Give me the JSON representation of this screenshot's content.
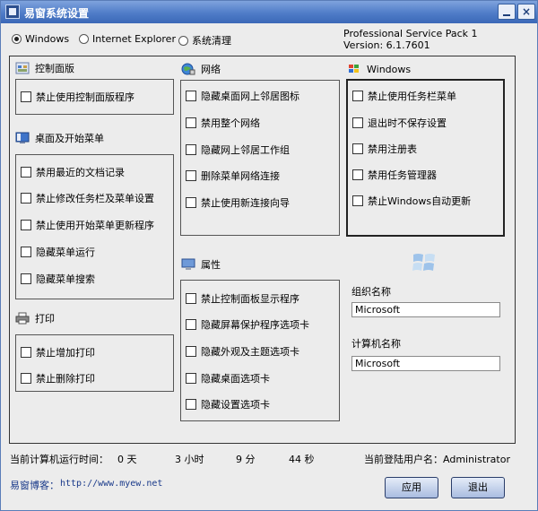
{
  "window": {
    "title": "易窗系统设置"
  },
  "tabs": [
    {
      "label": "Windows",
      "selected": true
    },
    {
      "label": "Internet Explorer",
      "selected": false
    },
    {
      "label": "系统清理",
      "selected": false
    }
  ],
  "sysinfo": {
    "line1": "Professional Service Pack 1",
    "line2": "Version: 6.1.7601"
  },
  "control_panel": {
    "title": "控制面版",
    "items": [
      "禁止使用控制面版程序"
    ]
  },
  "desktop_start": {
    "title": "桌面及开始菜单",
    "items": [
      "禁用最近的文档记录",
      "禁止修改任务栏及菜单设置",
      "禁止使用开始菜单更新程序",
      "隐藏菜单运行",
      "隐藏菜单搜索"
    ]
  },
  "print": {
    "title": "打印",
    "items": [
      "禁止增加打印",
      "禁止删除打印"
    ]
  },
  "network": {
    "title": "网络",
    "items": [
      "隐藏桌面网上邻居图标",
      "禁用整个网络",
      "隐藏网上邻居工作组",
      "删除菜单网络连接",
      "禁止使用新连接向导"
    ]
  },
  "properties": {
    "title": "属性",
    "items": [
      "禁止控制面板显示程序",
      "隐藏屏幕保护程序选项卡",
      "隐藏外观及主题选项卡",
      "隐藏桌面选项卡",
      "隐藏设置选项卡"
    ]
  },
  "windows_group": {
    "title": "Windows",
    "items": [
      "禁止使用任务栏菜单",
      "退出时不保存设置",
      "禁用注册表",
      "禁用任务管理器",
      "禁止Windows自动更新"
    ]
  },
  "org": {
    "label": "组织名称",
    "value": "Microsoft"
  },
  "computer": {
    "label": "计算机名称",
    "value": "Microsoft"
  },
  "status": {
    "uptime_label": "当前计算机运行时间：",
    "days": "0 天",
    "hours": "3 小时",
    "minutes": "9 分",
    "seconds": "44 秒",
    "user_label": "当前登陆用户名：Administrator"
  },
  "footer": {
    "blog_label": "易窗博客：",
    "blog_url": "http://www.myew.net",
    "apply": "应用",
    "exit": "退出"
  },
  "colors": {
    "titlebar": "#4f7cc8",
    "accent": "#3b68b7"
  },
  "icons": {
    "control_panel": "control-panel-icon",
    "desktop": "desktop-icon",
    "print": "printer-icon",
    "network": "network-globe-icon",
    "properties": "display-properties-icon",
    "windows": "windows-flag-icon"
  }
}
